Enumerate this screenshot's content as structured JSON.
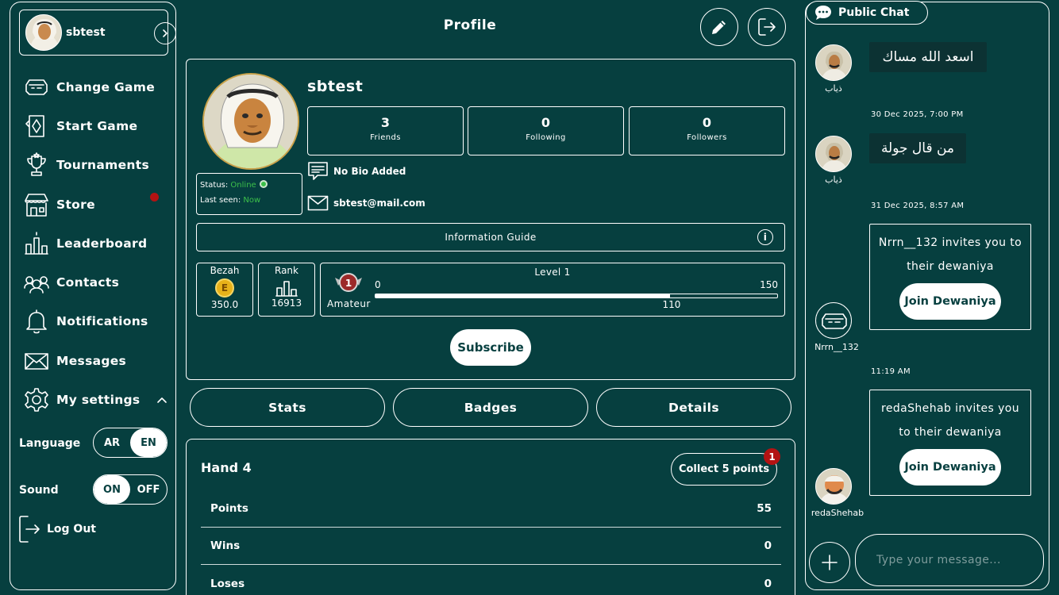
{
  "user": {
    "name": "sbtest"
  },
  "sidebar": {
    "items": [
      {
        "label": "Change Game",
        "icon": "game-board-icon"
      },
      {
        "label": "Start Game",
        "icon": "cards-icon"
      },
      {
        "label": "Tournaments",
        "icon": "trophy-icon"
      },
      {
        "label": "Store",
        "icon": "store-icon"
      },
      {
        "label": "Leaderboard",
        "icon": "leaderboard-icon"
      },
      {
        "label": "Contacts",
        "icon": "contacts-icon"
      },
      {
        "label": "Notifications",
        "icon": "bell-icon"
      },
      {
        "label": "Messages",
        "icon": "envelope-icon"
      },
      {
        "label": "My settings",
        "icon": "gear-icon"
      }
    ],
    "language_label": "Language",
    "language_options": [
      "AR",
      "EN"
    ],
    "language_selected": "EN",
    "sound_label": "Sound",
    "sound_options": [
      "ON",
      "OFF"
    ],
    "sound_selected": "ON",
    "logout_label": "Log Out"
  },
  "header": {
    "title": "Profile"
  },
  "profile": {
    "name": "sbtest",
    "stats": [
      {
        "value": "3",
        "label": "Friends"
      },
      {
        "value": "0",
        "label": "Following"
      },
      {
        "value": "0",
        "label": "Followers"
      }
    ],
    "status_label": "Status:",
    "status_value": "Online",
    "last_seen_label": "Last seen:",
    "last_seen_value": "Now",
    "bio": "No Bio Added",
    "email": "sbtest@mail.com",
    "info_guide": "Information Guide",
    "bezah_label": "Bezah",
    "bezah_value": "350.0",
    "rank_label": "Rank",
    "rank_value": "16913",
    "level_title": "Level 1",
    "level_rank_name": "Amateur",
    "level_min": "0",
    "level_max": "150",
    "level_current": "110",
    "level_progress": 0.7333,
    "subscribe_label": "Subscribe"
  },
  "tabs": [
    {
      "label": "Stats",
      "active": true
    },
    {
      "label": "Badges",
      "active": false
    },
    {
      "label": "Details",
      "active": false
    }
  ],
  "stats_panel": {
    "title": "Hand 4",
    "collect_label": "Collect 5 points",
    "collect_badge": "1",
    "rows": [
      {
        "label": "Points",
        "value": "55"
      },
      {
        "label": "Wins",
        "value": "0"
      },
      {
        "label": "Loses",
        "value": "0"
      }
    ]
  },
  "chat": {
    "title": "Public Chat",
    "messages": [
      {
        "user": "ذياب",
        "text": "اسعد الله مساك"
      },
      {
        "timestamp": "30 Dec 2025, 7:00 PM"
      },
      {
        "user": "ذياب",
        "text": "من قال جولة"
      },
      {
        "timestamp": "31 Dec 2025, 8:57 AM"
      },
      {
        "user": "Nrrn__132",
        "invite_text": "Nrrn__132 invites you to their dewaniya",
        "join_label": "Join Dewaniya"
      },
      {
        "timestamp": "11:19 AM"
      },
      {
        "user": "redaShehab",
        "invite_text": "redaShehab invites you to their dewaniya",
        "join_label": "Join Dewaniya"
      }
    ],
    "input_placeholder": "Type your message..."
  },
  "colors": {
    "background": "#063f3f",
    "accent_red": "#b31313",
    "online_green": "#3cc04a",
    "coin_gold": "#e8b21a"
  }
}
